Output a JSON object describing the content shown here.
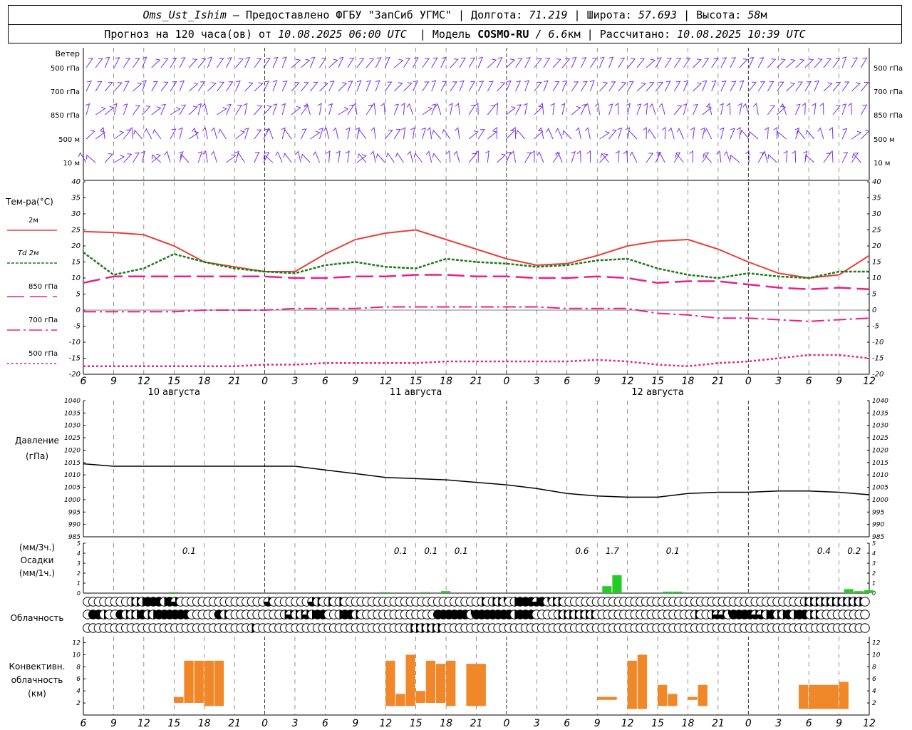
{
  "header": {
    "station": "Oms_Ust_Ishim",
    "provider": " – Предоставлено ФГБУ \"ЗапСиб УГМС\" | Долгота: ",
    "lon": "71.219",
    "lat_label": " | Широта: ",
    "lat": "57.693",
    "alt_label": " | Высота: ",
    "alt": "58",
    "alt_unit": "м",
    "forecast_label": "Прогноз на 120 часа(ов) от ",
    "forecast_time": "10.08.2025 06:00 UTC",
    "model_label": "  | Модель ",
    "model": "COSMO-RU",
    "model_res": " / 6.6",
    "model_res_unit": "км",
    "calc_label": " | Рассчитано: ",
    "calc_time": "10.08.2025 10:39 UTC"
  },
  "time_axis": {
    "hour_labels": [
      "6",
      "9",
      "12",
      "15",
      "18",
      "21",
      "0",
      "3",
      "6",
      "9",
      "12",
      "15",
      "18",
      "21",
      "0",
      "3",
      "6",
      "9",
      "12",
      "15",
      "18",
      "21",
      "0",
      "3",
      "6",
      "9",
      "12"
    ],
    "day_labels": [
      {
        "text": "10 августа",
        "hour": 9
      },
      {
        "text": "11 августа",
        "hour": 33
      },
      {
        "text": "12 августа",
        "hour": 57
      }
    ]
  },
  "wind_panel": {
    "title": "Ветер",
    "levels": [
      "500 гПа",
      "700 гПа",
      "850 гПа",
      "500 м",
      "10 м"
    ],
    "right_levels": [
      "500 гПа",
      "700 гПа",
      "850 гПа",
      "500 м",
      "10 м"
    ],
    "color": "#7a2ee6"
  },
  "chart_data": [
    {
      "type": "line",
      "panel": "temperature",
      "ylabel": "Тем-ра(°C)",
      "ylim": [
        -20,
        40
      ],
      "yticks": [
        -20,
        -15,
        -10,
        -5,
        0,
        5,
        10,
        15,
        20,
        25,
        30,
        35,
        40
      ],
      "x_hours": [
        0,
        3,
        6,
        9,
        12,
        15,
        18,
        21,
        24,
        27,
        30,
        33,
        36,
        39,
        42,
        45,
        48,
        51,
        54,
        57,
        60,
        63,
        66,
        69,
        72,
        75,
        78
      ],
      "series": [
        {
          "name": "2м",
          "color": "#e8403a",
          "values": [
            24.5,
            24.2,
            23.5,
            20,
            15,
            13.5,
            12,
            12,
            17.5,
            22,
            24,
            25,
            22,
            19,
            16,
            14,
            14.5,
            17,
            20,
            21.5,
            22,
            19,
            15,
            11.5,
            10,
            11,
            17
          ]
        },
        {
          "name": "Td  2м",
          "color": "#1a7a1a",
          "values": [
            18,
            11,
            13,
            17.5,
            15,
            13,
            12,
            11.5,
            14,
            15,
            13.5,
            13,
            16,
            15,
            14.5,
            13.5,
            14,
            15.5,
            16,
            13,
            11,
            10,
            11.5,
            10.5,
            10,
            12,
            12
          ]
        },
        {
          "name": "850 гПа",
          "color": "#e8208c",
          "values": [
            8.5,
            10.5,
            10.5,
            10.5,
            10.5,
            10.5,
            10.5,
            10,
            10,
            10.5,
            10.5,
            11,
            11,
            10.5,
            10.5,
            10,
            10,
            10.5,
            10,
            8.5,
            9,
            9,
            8,
            7,
            6.5,
            7,
            6.5
          ]
        },
        {
          "name": "700 гПа",
          "color": "#e8208c",
          "values": [
            -0.5,
            -0.5,
            -0.5,
            -0.5,
            0,
            0,
            0,
            0.5,
            0.5,
            0.5,
            1,
            1,
            1,
            1,
            1,
            1,
            0.5,
            0.5,
            0.5,
            -1,
            -1.5,
            -2.5,
            -2.5,
            -3,
            -3.5,
            -3,
            -2.5
          ]
        },
        {
          "name": "500 гПа",
          "color": "#e8208c",
          "values": [
            -17.5,
            -17.5,
            -17.5,
            -17.5,
            -17.5,
            -17.5,
            -17,
            -17,
            -16.5,
            -16.5,
            -16.5,
            -16.5,
            -16,
            -16,
            -16,
            -16,
            -16,
            -15.5,
            -16,
            -17,
            -17.5,
            -16.5,
            -16,
            -15,
            -14,
            -14,
            -15
          ]
        }
      ]
    },
    {
      "type": "line",
      "panel": "pressure",
      "ylabel": "Давление",
      "yunit": "(гПа)",
      "ylim": [
        985,
        1040
      ],
      "yticks": [
        985,
        990,
        995,
        1000,
        1005,
        1010,
        1015,
        1020,
        1025,
        1030,
        1035,
        1040
      ],
      "x_hours": [
        0,
        3,
        6,
        9,
        12,
        15,
        18,
        21,
        24,
        27,
        30,
        33,
        36,
        39,
        42,
        45,
        48,
        51,
        54,
        57,
        60,
        63,
        66,
        69,
        72,
        75,
        78
      ],
      "series": [
        {
          "name": "Давление",
          "color": "#000000",
          "values": [
            1014.5,
            1013.5,
            1013.5,
            1013.5,
            1013.5,
            1013.5,
            1013.5,
            1013.5,
            1012,
            1010.5,
            1009,
            1008.5,
            1008,
            1007,
            1006,
            1004.5,
            1002.5,
            1001.5,
            1001,
            1001,
            1002.5,
            1003,
            1003,
            1003.5,
            1003.5,
            1003,
            1002
          ]
        }
      ]
    },
    {
      "type": "bar",
      "panel": "precipitation",
      "ylabel": "(мм/3ч.)",
      "ylabel2": "Осадки",
      "ylabel3": "(мм/1ч.)",
      "ylim": [
        0,
        5
      ],
      "yticks": [
        0,
        1,
        2,
        3,
        4,
        5
      ],
      "color": "#22cc22",
      "bars": [
        {
          "hour": 9,
          "value": 0.1
        },
        {
          "hour": 30,
          "value": 0.1
        },
        {
          "hour": 34,
          "value": 0.1
        },
        {
          "hour": 36,
          "value": 0.2
        },
        {
          "hour": 52,
          "value": 0.7
        },
        {
          "hour": 53,
          "value": 1.8
        },
        {
          "hour": 58,
          "value": 0.15
        },
        {
          "hour": 59,
          "value": 0.15
        },
        {
          "hour": 76,
          "value": 0.4
        },
        {
          "hour": 77,
          "value": 0.2
        },
        {
          "hour": 78,
          "value": 0.3
        }
      ],
      "totals": [
        {
          "hour": 10.5,
          "text": "0.1"
        },
        {
          "hour": 31.5,
          "text": "0.1"
        },
        {
          "hour": 34.5,
          "text": "0.1"
        },
        {
          "hour": 37.5,
          "text": "0.1"
        },
        {
          "hour": 49.5,
          "text": "0.6"
        },
        {
          "hour": 52.5,
          "text": "1.7"
        },
        {
          "hour": 58.5,
          "text": "0.1"
        },
        {
          "hour": 73.5,
          "text": "0.4"
        },
        {
          "hour": 76.5,
          "text": "0.2"
        }
      ]
    },
    {
      "type": "bar",
      "panel": "convective_cloud",
      "ylabel": "Конвективн.",
      "ylabel2": "облачность",
      "ylabel3": "(км)",
      "ylim": [
        0,
        13
      ],
      "yticks": [
        2,
        4,
        6,
        8,
        10,
        12
      ],
      "color": "#f0882a",
      "bars": [
        {
          "h0": 9.0,
          "h1": 10.0,
          "base": 2.0,
          "top": 3.0
        },
        {
          "h0": 10.0,
          "h1": 11.0,
          "base": 2.0,
          "top": 9.0
        },
        {
          "h0": 11.0,
          "h1": 12.0,
          "base": 2.0,
          "top": 9.0
        },
        {
          "h0": 12.0,
          "h1": 13.0,
          "base": 1.5,
          "top": 9.0
        },
        {
          "h0": 13.0,
          "h1": 14.0,
          "base": 1.5,
          "top": 9.0
        },
        {
          "h0": 30.0,
          "h1": 31.0,
          "base": 1.5,
          "top": 9.0
        },
        {
          "h0": 31.0,
          "h1": 32.0,
          "base": 1.5,
          "top": 3.5
        },
        {
          "h0": 32.0,
          "h1": 33.0,
          "base": 1.5,
          "top": 10.0
        },
        {
          "h0": 33.0,
          "h1": 34.0,
          "base": 2.0,
          "top": 4.0
        },
        {
          "h0": 34.0,
          "h1": 35.0,
          "base": 2.0,
          "top": 9.0
        },
        {
          "h0": 35.0,
          "h1": 36.0,
          "base": 2.0,
          "top": 8.5
        },
        {
          "h0": 36.0,
          "h1": 37.0,
          "base": 1.5,
          "top": 9.0
        },
        {
          "h0": 38.0,
          "h1": 40.0,
          "base": 1.5,
          "top": 8.5
        },
        {
          "h0": 51.0,
          "h1": 53.0,
          "base": 2.5,
          "top": 3.0
        },
        {
          "h0": 54.0,
          "h1": 55.0,
          "base": 1.0,
          "top": 9.0
        },
        {
          "h0": 55.0,
          "h1": 56.0,
          "base": 1.0,
          "top": 10.0
        },
        {
          "h0": 57.0,
          "h1": 58.0,
          "base": 1.5,
          "top": 5.0
        },
        {
          "h0": 58.0,
          "h1": 59.0,
          "base": 1.5,
          "top": 3.5
        },
        {
          "h0": 60.0,
          "h1": 61.0,
          "base": 2.5,
          "top": 3.0
        },
        {
          "h0": 61.0,
          "h1": 62.0,
          "base": 1.5,
          "top": 5.0
        },
        {
          "h0": 71.0,
          "h1": 72.0,
          "base": 1.0,
          "top": 5.0
        },
        {
          "h0": 72.0,
          "h1": 75.0,
          "base": 1.0,
          "top": 5.0
        },
        {
          "h0": 75.0,
          "h1": 76.0,
          "base": 1.0,
          "top": 5.5
        }
      ]
    }
  ],
  "cloud_panel": {
    "title": "Облачность",
    "rows": [
      "00000000222444243000000000000000030000000320202000000000000000000000000020221024443412200000000000000000000000000000000000000000000222222222220",
      "04420042224224444440000042000000000023223244002442000000000000004444441444444424440000222222200000000000000000020023314444332422424422000000000",
      "00000000000000000000000000000020000000000000000000000000000222222000000000000000000000000000000000000000000000000000000000000000000000000000000"
    ]
  }
}
